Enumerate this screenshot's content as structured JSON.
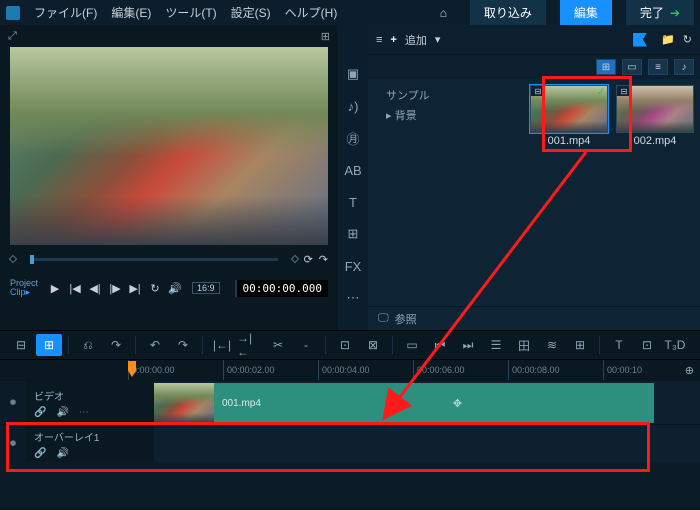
{
  "menu": {
    "items": [
      "ファイル(F)",
      "編集(E)",
      "ツール(T)",
      "設定(S)",
      "ヘルプ(H)"
    ],
    "home_icon": "⌂",
    "capture": "取り込み",
    "edit": "編集",
    "done": "完了"
  },
  "preview": {
    "expand_icon": "⤢",
    "marker_icon": "◆",
    "loop_icon": "⟳",
    "goto_icon": "↷",
    "project_label": "Project",
    "clip_label": "Clip▸",
    "play_icon": "▶",
    "start_icon": "|◀",
    "prev_icon": "◀|",
    "next_icon": "|▶",
    "end_icon": "▶|",
    "repeat_icon": "↻",
    "volume_icon": "🔊",
    "aspect": "16:9",
    "timecode": "00:00:00.000",
    "snap_icon": "⊞"
  },
  "tool_col": [
    "▣",
    "♪)",
    "㊊",
    "AB",
    "T",
    "⊞",
    "FX",
    "⋯"
  ],
  "library": {
    "menu_icon": "≡",
    "plus": "+",
    "add": "追加",
    "dropdown": "▾",
    "folder_icon": "📁",
    "rotate_icon": "↻",
    "views": [
      "⊞",
      "▭",
      "≡",
      "♪"
    ],
    "tree": {
      "sample": "サンプル",
      "bg": "▸ 背景"
    },
    "items": [
      {
        "film_icon": "⊟",
        "check": "✓",
        "caption": "001.mp4",
        "selected": true
      },
      {
        "film_icon": "⊟",
        "caption": "002.mp4",
        "selected": false
      }
    ],
    "browse_icon": "🖵",
    "browse": "参照"
  },
  "tstrip": {
    "storyboard": "⊟",
    "timeline": "⊞",
    "btns": [
      "⎌",
      "↷",
      "↶",
      "↷",
      "|←|",
      "→|←",
      "✂",
      "-",
      "⊡",
      "⊠",
      "▭",
      "⏮",
      "⏭",
      "☰",
      "田",
      "≋",
      "⊞",
      "T",
      "⊡",
      "T₃D"
    ]
  },
  "timeline": {
    "ticks": [
      "0:00:00.00",
      "00:00:02.00",
      "00:00:04.00",
      "00:00:06.00",
      "00:00:08.00",
      "00:00:10"
    ],
    "zoom": "⊕",
    "tracks": {
      "video": {
        "label": "ビデオ",
        "cam": "⏺",
        "link": "🔗",
        "vol": "🔊",
        "more": "⋯",
        "clip_label": "001.mp4",
        "move": "✥"
      },
      "overlay": {
        "label": "オーバーレイ1",
        "cam": "⏺",
        "link": "🔗",
        "vol": "🔊"
      }
    }
  }
}
